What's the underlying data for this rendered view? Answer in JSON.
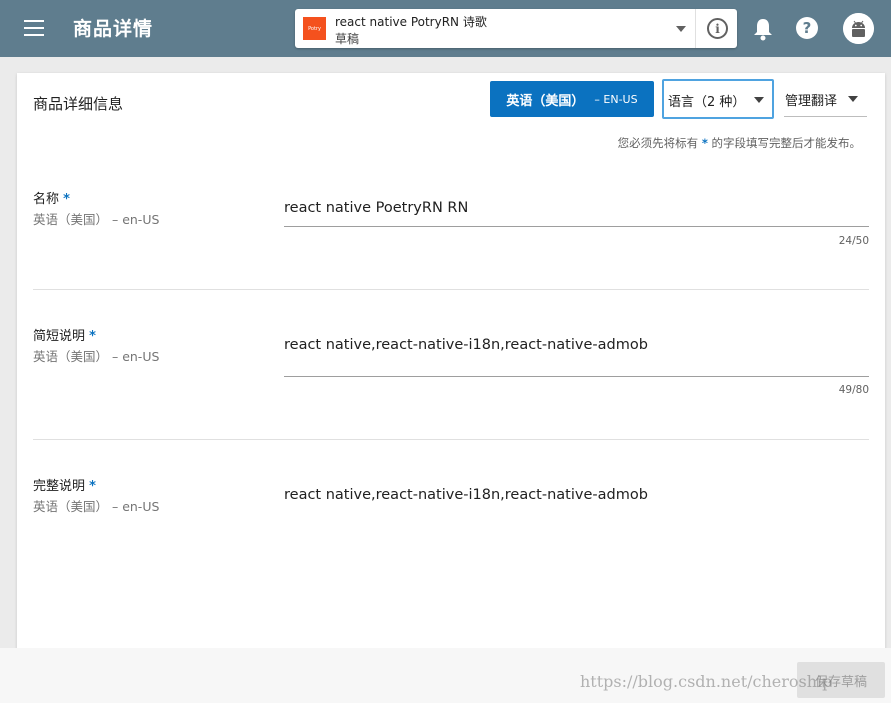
{
  "header": {
    "title": "商品详情",
    "app_name": "react native PotryRN 诗歌",
    "app_status": "草稿",
    "app_logo_text": "Potry"
  },
  "card": {
    "title": "商品详细信息",
    "language_button": {
      "label": "英语（美国）",
      "code": "– EN-US"
    },
    "language_select": "语言（2 种）",
    "manage_translation": "管理翻译",
    "notice_before": "您必须先将标有",
    "notice_star": "*",
    "notice_after": "的字段填写完整后才能发布。"
  },
  "fields": [
    {
      "label": "名称",
      "star": "*",
      "sub": "英语（美国）  – en-US",
      "value": "react native PoetryRN RN",
      "counter": "24/50"
    },
    {
      "label": "简短说明",
      "star": "*",
      "sub": "英语（美国）  – en-US",
      "value": "react native,react-native-i18n,react-native-admob",
      "counter": "49/80"
    },
    {
      "label": "完整说明",
      "star": "*",
      "sub": "英语（美国）  – en-US",
      "value": "react native,react-native-i18n,react-native-admob"
    }
  ],
  "footer": {
    "save_label": "保存草稿",
    "watermark": "https://blog.csdn.net/cheroship"
  },
  "colors": {
    "topbar": "#5f7d8e",
    "primary": "#0b72c0",
    "focus_border": "#4fa3e0",
    "logo": "#f4511e"
  },
  "icons": [
    "menu-icon",
    "info-icon",
    "bell-icon",
    "help-icon",
    "android-avatar-icon",
    "chevron-down-icon"
  ]
}
